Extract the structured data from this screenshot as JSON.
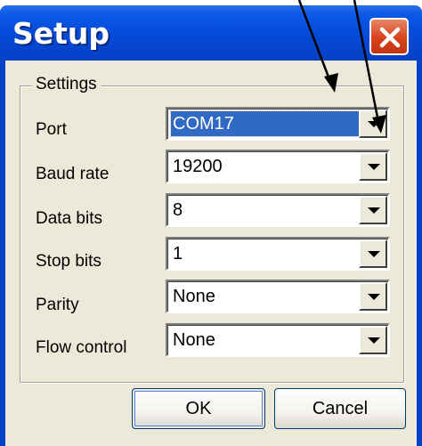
{
  "window": {
    "title": "Setup",
    "close_icon": "close-x-icon",
    "title_color": "#0548d6",
    "close_color": "#d8431c"
  },
  "settings": {
    "group_label": "Settings",
    "fields": [
      {
        "label": "Port",
        "value": "COM17",
        "selected": true
      },
      {
        "label": "Baud rate",
        "value": "19200"
      },
      {
        "label": "Data bits",
        "value": "8"
      },
      {
        "label": "Stop bits",
        "value": "1"
      },
      {
        "label": "Parity",
        "value": "None"
      },
      {
        "label": "Flow control",
        "value": "None"
      }
    ]
  },
  "buttons": {
    "ok": "OK",
    "cancel": "Cancel"
  },
  "annotation": {
    "type": "two arrows pointing at Port combo box",
    "color": "#000000"
  }
}
